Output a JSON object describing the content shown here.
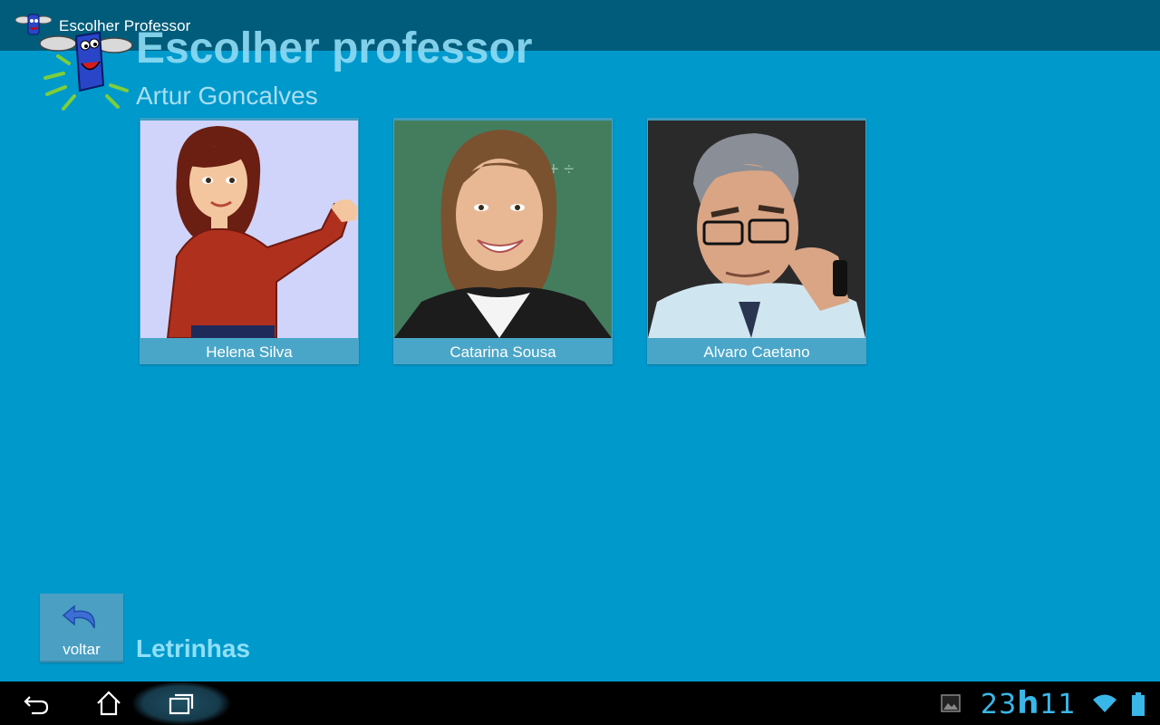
{
  "actionbar": {
    "title": "Escolher Professor",
    "icon": "app-logo-icon"
  },
  "header": {
    "title": "Escolher professor",
    "student_name": "Artur Goncalves"
  },
  "teachers": [
    {
      "name": "Helena Silva"
    },
    {
      "name": "Catarina Sousa"
    },
    {
      "name": "Alvaro Caetano"
    }
  ],
  "footer": {
    "back_label": "voltar",
    "app_name": "Letrinhas"
  },
  "status": {
    "clock_hours": "23",
    "clock_sep": "h",
    "clock_minutes": "11"
  },
  "colors": {
    "background": "#0099cc",
    "actionbar": "#005c7a",
    "card": "#4aa6c8",
    "accent": "#39b7e8"
  }
}
